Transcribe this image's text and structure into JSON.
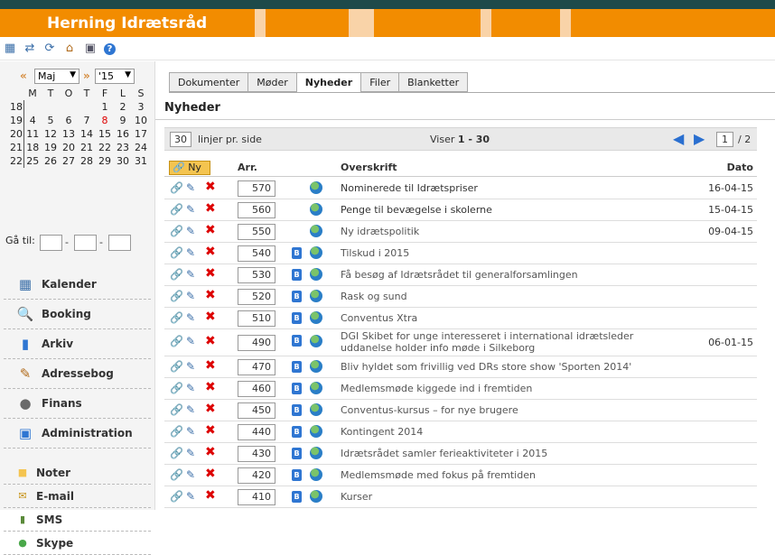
{
  "app": {
    "brand": "Herning Idrætsråd"
  },
  "toolbar": {
    "icons": [
      "calendar-icon",
      "swap-icon",
      "refresh-icon",
      "home-icon",
      "computer-icon",
      "help-icon"
    ]
  },
  "calendar": {
    "prev": "«",
    "next": "»",
    "month": "Maj",
    "year": "'15",
    "weekdays": [
      "M",
      "T",
      "O",
      "T",
      "F",
      "L",
      "S"
    ],
    "weeks": [
      {
        "wk": "18",
        "days": [
          "",
          "",
          "",
          "",
          "1",
          "2",
          "3"
        ]
      },
      {
        "wk": "19",
        "days": [
          "4",
          "5",
          "6",
          "7",
          "8",
          "9",
          "10"
        ]
      },
      {
        "wk": "20",
        "days": [
          "11",
          "12",
          "13",
          "14",
          "15",
          "16",
          "17"
        ]
      },
      {
        "wk": "21",
        "days": [
          "18",
          "19",
          "20",
          "21",
          "22",
          "23",
          "24"
        ]
      },
      {
        "wk": "22",
        "days": [
          "25",
          "26",
          "27",
          "28",
          "29",
          "30",
          "31"
        ]
      }
    ],
    "highlight_day": "8",
    "goto_label": "Gå til:",
    "goto_sep": "-"
  },
  "menu": [
    {
      "label": "Kalender",
      "icon": "calendar-icon"
    },
    {
      "label": "Booking",
      "icon": "booking-icon"
    },
    {
      "label": "Arkiv",
      "icon": "archive-icon"
    },
    {
      "label": "Adressebog",
      "icon": "addressbook-icon"
    },
    {
      "label": "Finans",
      "icon": "finance-icon"
    },
    {
      "label": "Administration",
      "icon": "administration-icon"
    }
  ],
  "menu2": [
    {
      "label": "Noter",
      "icon": "notes-icon"
    },
    {
      "label": "E-mail",
      "icon": "email-icon"
    },
    {
      "label": "SMS",
      "icon": "sms-icon"
    },
    {
      "label": "Skype",
      "icon": "skype-icon"
    }
  ],
  "tabs": [
    {
      "label": "Dokumenter",
      "active": false
    },
    {
      "label": "Møder",
      "active": false
    },
    {
      "label": "Nyheder",
      "active": true
    },
    {
      "label": "Filer",
      "active": false
    },
    {
      "label": "Blanketter",
      "active": false
    }
  ],
  "page": {
    "title": "Nyheder"
  },
  "pager": {
    "per_page": "30",
    "per_page_label": "linjer pr. side",
    "viser_label": "Viser",
    "range": "1 - 30",
    "current_page": "1",
    "total": "/ 2"
  },
  "list": {
    "new_label": "Ny",
    "col_arr": "Arr.",
    "col_title": "Overskrift",
    "col_date": "Dato",
    "rows": [
      {
        "arr": "570",
        "title": "Nominerede til Idrætspriser",
        "date": "16-04-15",
        "archive": false,
        "active": true
      },
      {
        "arr": "560",
        "title": "Penge til bevægelse i skolerne",
        "date": "15-04-15",
        "archive": false,
        "active": true
      },
      {
        "arr": "550",
        "title": "Ny idrætspolitik",
        "date": "09-04-15",
        "archive": false,
        "active": false
      },
      {
        "arr": "540",
        "title": "Tilskud i 2015",
        "date": "",
        "archive": true,
        "active": false
      },
      {
        "arr": "530",
        "title": "Få besøg af Idrætsrådet til generalforsamlingen",
        "date": "",
        "archive": true,
        "active": false
      },
      {
        "arr": "520",
        "title": "Rask og sund",
        "date": "",
        "archive": true,
        "active": false
      },
      {
        "arr": "510",
        "title": "Conventus Xtra",
        "date": "",
        "archive": true,
        "active": false
      },
      {
        "arr": "490",
        "title": "DGI Skibet for unge interesseret i international idrætsleder uddanelse holder info møde i Silkeborg",
        "date": "06-01-15",
        "archive": true,
        "active": false
      },
      {
        "arr": "470",
        "title": "Bliv hyldet som frivillig ved DRs store show 'Sporten 2014'",
        "date": "",
        "archive": true,
        "active": false
      },
      {
        "arr": "460",
        "title": "Medlemsmøde kiggede ind i fremtiden",
        "date": "",
        "archive": true,
        "active": false
      },
      {
        "arr": "450",
        "title": "Conventus-kursus – for nye brugere",
        "date": "",
        "archive": true,
        "active": false
      },
      {
        "arr": "440",
        "title": "Kontingent 2014",
        "date": "",
        "archive": true,
        "active": false
      },
      {
        "arr": "430",
        "title": "Idrætsrådet samler ferieaktiviteter i 2015",
        "date": "",
        "archive": true,
        "active": false
      },
      {
        "arr": "420",
        "title": "Medlemsmøde med fokus på fremtiden",
        "date": "",
        "archive": true,
        "active": false
      },
      {
        "arr": "410",
        "title": "Kurser",
        "date": "",
        "archive": true,
        "active": false
      }
    ]
  },
  "colors": {
    "brand": "#f28c00",
    "topbar": "#1e4a4a",
    "accent": "#2f76d2"
  }
}
